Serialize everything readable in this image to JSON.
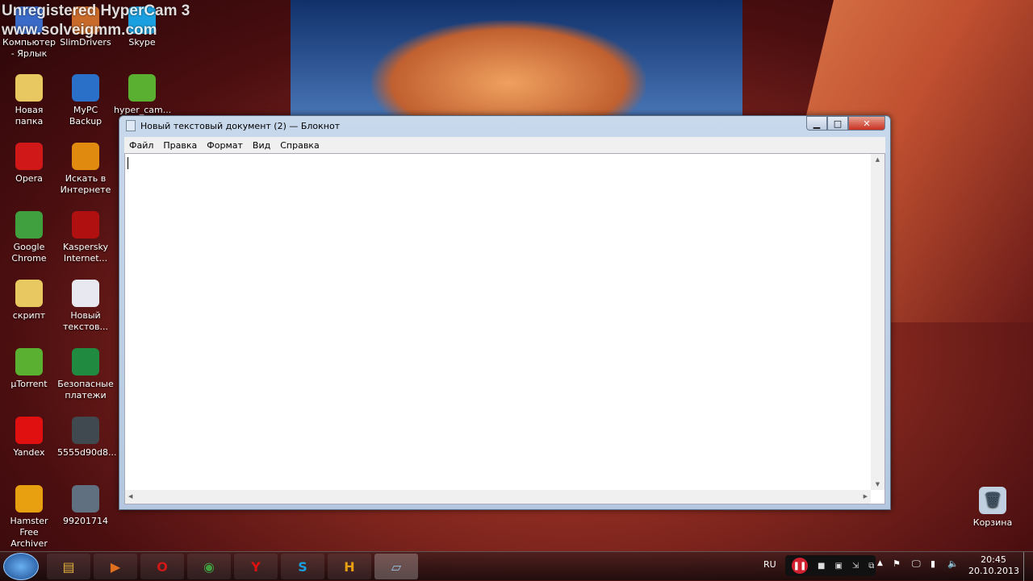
{
  "watermark": {
    "line1": "Unregistered HyperCam 3",
    "line2": "www.solveigmm.com"
  },
  "desktop_icons": [
    {
      "label": "Компьютер - Ярлык",
      "icon": "computer-icon",
      "color": "#3a6ac8"
    },
    {
      "label": "SlimDrivers",
      "icon": "slimdrivers-icon",
      "color": "#c86a2a"
    },
    {
      "label": "Skype",
      "icon": "skype-icon",
      "color": "#1aa0e0"
    },
    {
      "label": "Новая папка",
      "icon": "folder-icon",
      "color": "#e8c860"
    },
    {
      "label": "MyPC Backup",
      "icon": "backup-icon",
      "color": "#2a70c8"
    },
    {
      "label": "hyper_cam...",
      "icon": "utorrent-icon",
      "color": "#5ab030"
    },
    {
      "label": "Opera",
      "icon": "opera-icon",
      "color": "#d01818"
    },
    {
      "label": "Искать в Интернете",
      "icon": "search-web-icon",
      "color": "#e08a10"
    },
    {
      "label": "Google Chrome",
      "icon": "chrome-icon",
      "color": "#40a040"
    },
    {
      "label": "Kaspersky Internet...",
      "icon": "kaspersky-icon",
      "color": "#b01010"
    },
    {
      "label": "скрипт",
      "icon": "folder-icon",
      "color": "#e8c860"
    },
    {
      "label": "Новый текстов...",
      "icon": "text-file-icon",
      "color": "#e8e8f0"
    },
    {
      "label": "µTorrent",
      "icon": "utorrent-icon",
      "color": "#5ab030"
    },
    {
      "label": "Безопасные платежи",
      "icon": "safe-payment-icon",
      "color": "#208a40"
    },
    {
      "label": "Yandex",
      "icon": "yandex-icon",
      "color": "#e01010"
    },
    {
      "label": "5555d90d8...",
      "icon": "image-file-icon",
      "color": "#404850"
    },
    {
      "label": "Hamster Free Archiver",
      "icon": "hamster-icon",
      "color": "#e8a010"
    },
    {
      "label": "99201714",
      "icon": "image-file-icon",
      "color": "#607080"
    }
  ],
  "recycle_bin": {
    "label": "Корзина",
    "icon": "recycle-bin-icon"
  },
  "notepad": {
    "title": "Новый текстовый документ (2) — Блокнот",
    "menu": [
      "Файл",
      "Правка",
      "Формат",
      "Вид",
      "Справка"
    ],
    "content": ""
  },
  "taskbar": {
    "apps": [
      {
        "name": "explorer",
        "glyph": "▤",
        "color": "#e0b040"
      },
      {
        "name": "media-player",
        "glyph": "▶",
        "color": "#e07020"
      },
      {
        "name": "opera",
        "glyph": "O",
        "color": "#d01818"
      },
      {
        "name": "chrome",
        "glyph": "◉",
        "color": "#40a040"
      },
      {
        "name": "yandex",
        "glyph": "Y",
        "color": "#e01010"
      },
      {
        "name": "skype",
        "glyph": "S",
        "color": "#1aa0e0"
      },
      {
        "name": "hamster",
        "glyph": "H",
        "color": "#e8a010"
      },
      {
        "name": "notepad",
        "glyph": "▱",
        "color": "#9ac0e0"
      }
    ],
    "lang": "RU",
    "time": "20:45",
    "date": "20.10.2013"
  }
}
